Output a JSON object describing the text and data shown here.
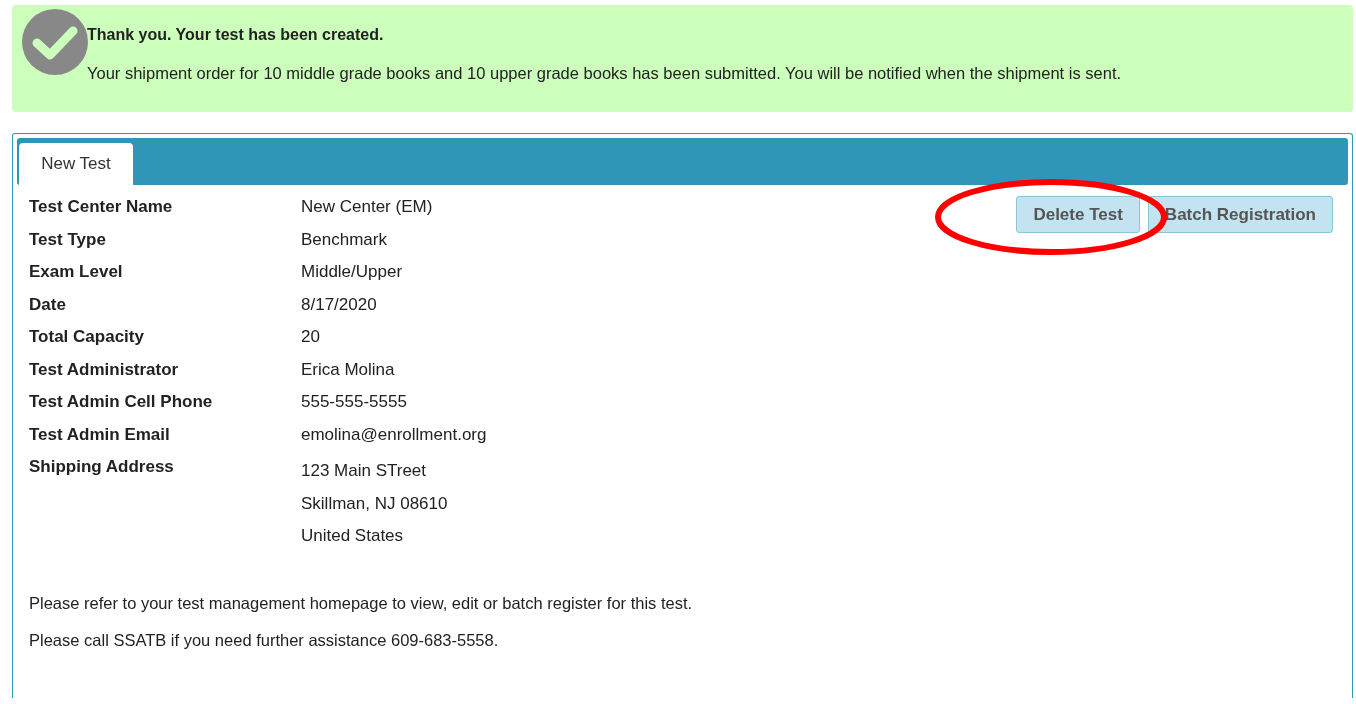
{
  "alert": {
    "title": "Thank you. Your test has been created.",
    "message": "Your shipment order for 10 middle grade books and 10 upper grade books has been submitted. You will be notified when the shipment is sent."
  },
  "tabs": [
    {
      "label": "New Test",
      "selected": true
    }
  ],
  "details": [
    {
      "label": "Test Center Name",
      "value": [
        "New Center (EM)"
      ]
    },
    {
      "label": "Test Type",
      "value": [
        "Benchmark"
      ]
    },
    {
      "label": "Exam Level",
      "value": [
        "Middle/Upper"
      ]
    },
    {
      "label": "Date",
      "value": [
        "8/17/2020"
      ]
    },
    {
      "label": "Total Capacity",
      "value": [
        "20"
      ]
    },
    {
      "label": "Test Administrator",
      "value": [
        "Erica Molina"
      ]
    },
    {
      "label": "Test Admin Cell Phone",
      "value": [
        "555-555-5555"
      ]
    },
    {
      "label": "Test Admin Email",
      "value": [
        "emolina@enrollment.org"
      ]
    },
    {
      "label": "Shipping Address",
      "value": [
        "123 Main STreet",
        "Skillman, NJ 08610",
        "United States"
      ]
    }
  ],
  "buttons": [
    "Delete Test",
    "Batch Registration"
  ],
  "notes": [
    "Please refer to your test management homepage to view, edit or batch register for this test.",
    "Please call SSATB if you need further assistance 609-683-5558."
  ]
}
